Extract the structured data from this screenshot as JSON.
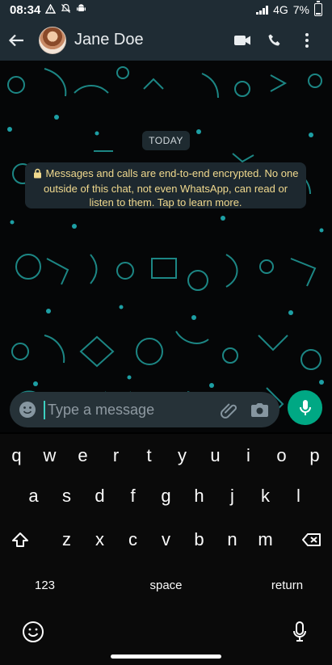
{
  "status_bar": {
    "time": "08:34",
    "network": "4G",
    "battery": "7%",
    "icons": [
      "warning-icon",
      "no-notifications-icon",
      "android-icon",
      "signal-icon",
      "battery-icon"
    ]
  },
  "header": {
    "contact_name": "Jane Doe",
    "icons": [
      "back-arrow-icon",
      "avatar",
      "video-call-icon",
      "voice-call-icon",
      "more-vert-icon"
    ]
  },
  "chat": {
    "date_chip": "TODAY",
    "encryption_notice": "Messages and calls are end-to-end encrypted. No one outside of this chat, not even WhatsApp, can read or listen to them. Tap to learn more.",
    "background_color": "#050607"
  },
  "composer": {
    "placeholder": "Type a message",
    "icons": [
      "emoji-icon",
      "attach-icon",
      "camera-icon",
      "mic-icon"
    ],
    "accent_color": "#00a884"
  },
  "keyboard": {
    "row1": [
      "q",
      "w",
      "e",
      "r",
      "t",
      "y",
      "u",
      "i",
      "o",
      "p"
    ],
    "row2": [
      "a",
      "s",
      "d",
      "f",
      "g",
      "h",
      "j",
      "k",
      "l"
    ],
    "row3": [
      "z",
      "x",
      "c",
      "v",
      "b",
      "n",
      "m"
    ],
    "numbers_key": "123",
    "space_key": "space",
    "return_key": "return",
    "icons": [
      "shift-icon",
      "backspace-icon",
      "emoji-keyboard-icon",
      "dictation-icon"
    ]
  }
}
